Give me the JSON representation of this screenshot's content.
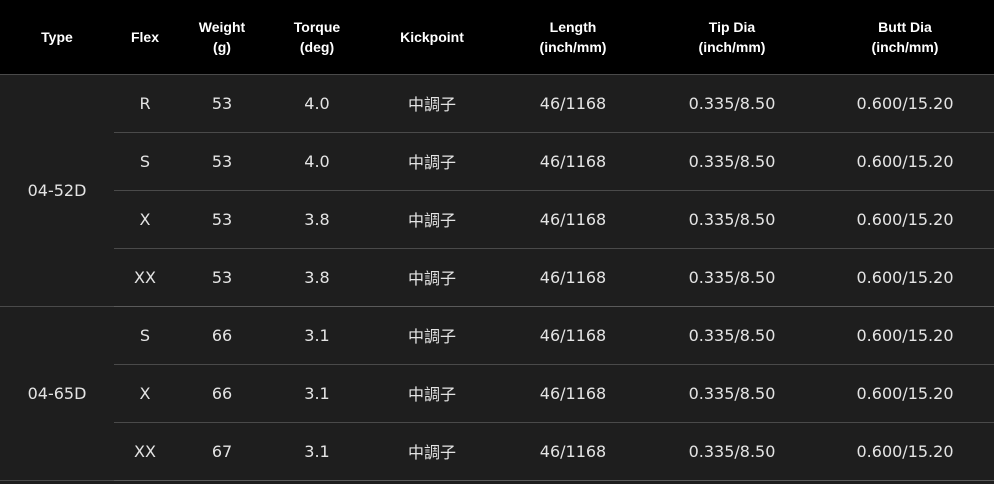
{
  "table": {
    "headers": [
      {
        "line1": "Type",
        "line2": ""
      },
      {
        "line1": "Flex",
        "line2": ""
      },
      {
        "line1": "Weight",
        "line2": "(g)"
      },
      {
        "line1": "Torque",
        "line2": "(deg)"
      },
      {
        "line1": "Kickpoint",
        "line2": ""
      },
      {
        "line1": "Length",
        "line2": "(inch/mm)"
      },
      {
        "line1": "Tip Dia",
        "line2": "(inch/mm)"
      },
      {
        "line1": "Butt Dia",
        "line2": "(inch/mm)"
      }
    ],
    "groups": [
      {
        "type": "04-52D",
        "rows": [
          {
            "flex": "R",
            "weight": "53",
            "torque": "4.0",
            "kickpoint": "中調子",
            "length": "46/1168",
            "tip": "0.335/8.50",
            "butt": "0.600/15.20"
          },
          {
            "flex": "S",
            "weight": "53",
            "torque": "4.0",
            "kickpoint": "中調子",
            "length": "46/1168",
            "tip": "0.335/8.50",
            "butt": "0.600/15.20"
          },
          {
            "flex": "X",
            "weight": "53",
            "torque": "3.8",
            "kickpoint": "中調子",
            "length": "46/1168",
            "tip": "0.335/8.50",
            "butt": "0.600/15.20"
          },
          {
            "flex": "XX",
            "weight": "53",
            "torque": "3.8",
            "kickpoint": "中調子",
            "length": "46/1168",
            "tip": "0.335/8.50",
            "butt": "0.600/15.20"
          }
        ]
      },
      {
        "type": "04-65D",
        "rows": [
          {
            "flex": "S",
            "weight": "66",
            "torque": "3.1",
            "kickpoint": "中調子",
            "length": "46/1168",
            "tip": "0.335/8.50",
            "butt": "0.600/15.20"
          },
          {
            "flex": "X",
            "weight": "66",
            "torque": "3.1",
            "kickpoint": "中調子",
            "length": "46/1168",
            "tip": "0.335/8.50",
            "butt": "0.600/15.20"
          },
          {
            "flex": "XX",
            "weight": "67",
            "torque": "3.1",
            "kickpoint": "中調子",
            "length": "46/1168",
            "tip": "0.335/8.50",
            "butt": "0.600/15.20"
          }
        ]
      }
    ]
  }
}
